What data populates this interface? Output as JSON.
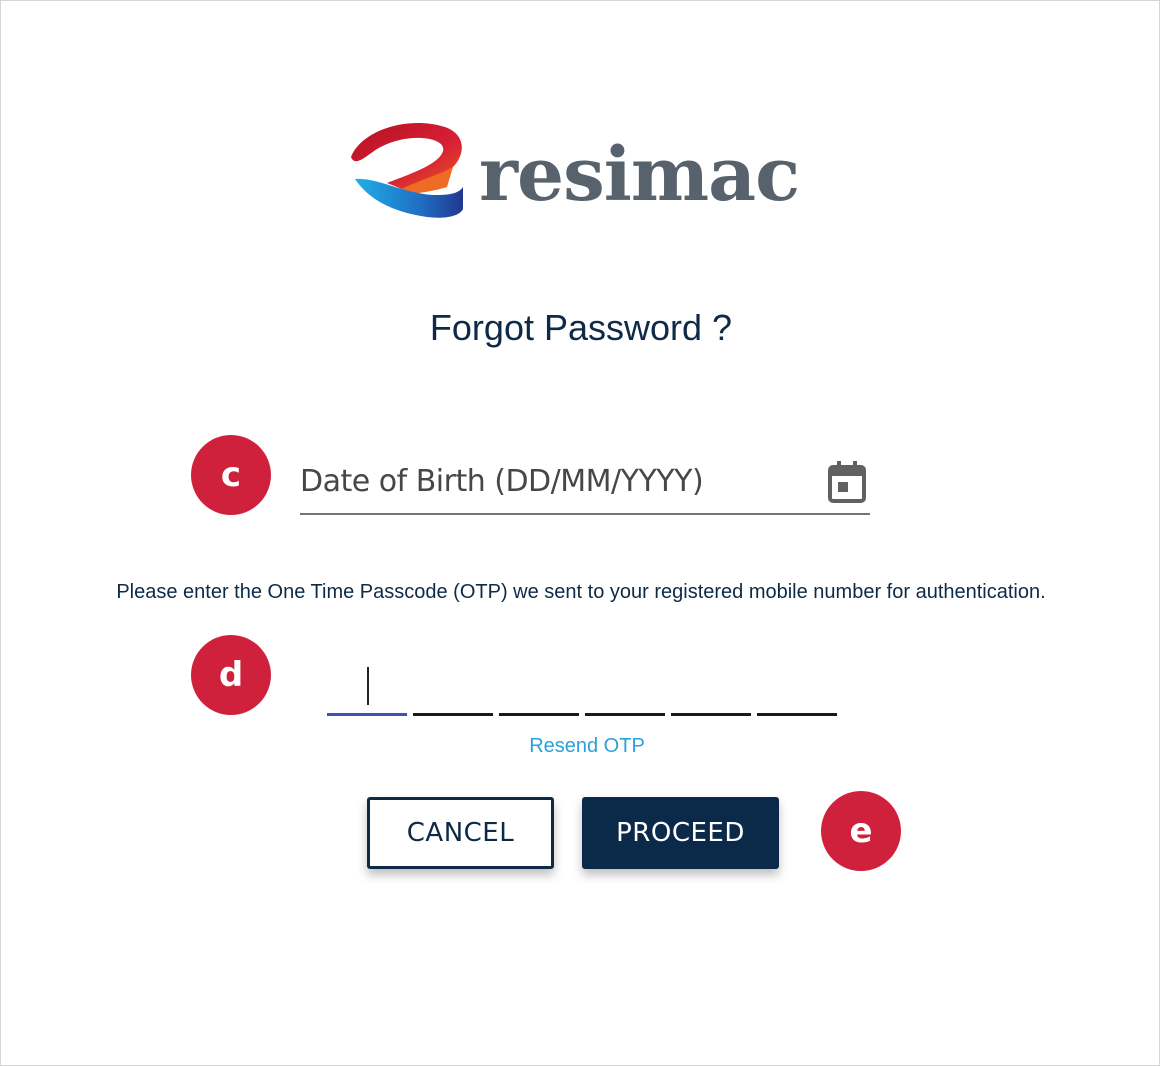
{
  "brand": {
    "name": "resimac",
    "logo_colors": [
      "#c8102e",
      "#e8541e",
      "#1ea7e1",
      "#1b3f9a"
    ]
  },
  "page": {
    "title": "Forgot Password ?"
  },
  "badges": {
    "c": "c",
    "d": "d",
    "e": "e"
  },
  "dob": {
    "label": "Date of Birth (DD/MM/YYYY)",
    "icon": "calendar-icon"
  },
  "otp": {
    "instruction": "Please enter the One Time Passcode (OTP) we sent to your registered mobile number for authentication.",
    "digits": [
      "",
      "",
      "",
      "",
      "",
      ""
    ],
    "resend_label": "Resend OTP"
  },
  "actions": {
    "cancel_label": "CANCEL",
    "proceed_label": "PROCEED"
  },
  "colors": {
    "badge": "#d0213c",
    "navy": "#0b2a4a",
    "link": "#2aa1d8",
    "active_underline": "#3f51b5"
  }
}
